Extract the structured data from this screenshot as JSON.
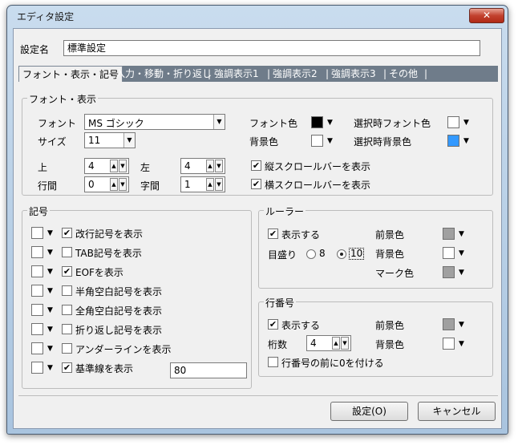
{
  "window": {
    "title": "エディタ設定",
    "close_label": "✕"
  },
  "setting_name": {
    "label": "設定名",
    "value": "標準設定"
  },
  "tabs": [
    {
      "label": "フォント・表示・記号",
      "active": true
    },
    {
      "label": "入力・移動・折り返し"
    },
    {
      "label": "強調表示1"
    },
    {
      "label": "強調表示2"
    },
    {
      "label": "強調表示3"
    },
    {
      "label": "その他"
    }
  ],
  "tab_separator": "|",
  "font_group": {
    "title": "フォント・表示",
    "font_label": "フォント",
    "font_value": "MS ゴシック",
    "size_label": "サイズ",
    "size_value": "11",
    "top_label": "上",
    "top_value": "4",
    "left_label": "左",
    "left_value": "4",
    "line_gap_label": "行間",
    "line_gap_value": "0",
    "char_gap_label": "字間",
    "char_gap_value": "1",
    "font_color_label": "フォント色",
    "font_color": "#000000",
    "bg_color_label": "背景色",
    "bg_color": "#ffffff",
    "sel_font_color_label": "選択時フォント色",
    "sel_font_color": "#ffffff",
    "sel_bg_color_label": "選択時背景色",
    "sel_bg_color": "#3399ff",
    "vscroll_label": "縦スクロールバーを表示",
    "vscroll_checked": true,
    "hscroll_label": "横スクロールバーを表示",
    "hscroll_checked": true
  },
  "symbol_group": {
    "title": "記号",
    "items": [
      {
        "label": "改行記号を表示",
        "checked": true
      },
      {
        "label": "TAB記号を表示",
        "checked": false
      },
      {
        "label": "EOFを表示",
        "checked": true
      },
      {
        "label": "半角空白記号を表示",
        "checked": false
      },
      {
        "label": "全角空白記号を表示",
        "checked": false
      },
      {
        "label": "折り返し記号を表示",
        "checked": false
      },
      {
        "label": "アンダーラインを表示",
        "checked": false
      },
      {
        "label": "基準線を表示",
        "checked": true
      }
    ],
    "baseline_value": "80"
  },
  "ruler_group": {
    "title": "ルーラー",
    "show_label": "表示する",
    "show_checked": true,
    "scale_label": "目盛り",
    "scale_opt1": "8",
    "scale_opt2": "10",
    "scale_selected": "10",
    "fg_label": "前景色",
    "fg_color": "#a0a0a0",
    "bg_label": "背景色",
    "bg_color": "#ffffff",
    "mark_label": "マーク色",
    "mark_color": "#a0a0a0"
  },
  "linenum_group": {
    "title": "行番号",
    "show_label": "表示する",
    "show_checked": true,
    "digits_label": "桁数",
    "digits_value": "4",
    "fg_label": "前景色",
    "fg_color": "#a0a0a0",
    "bg_label": "背景色",
    "bg_color": "#ffffff",
    "zero_label": "行番号の前に0を付ける",
    "zero_checked": false
  },
  "footer": {
    "ok_label": "設定(O)",
    "cancel_label": "キャンセル"
  },
  "glyphs": {
    "check": "✔",
    "dropdown": "▼",
    "up": "▲",
    "down": "▼"
  }
}
